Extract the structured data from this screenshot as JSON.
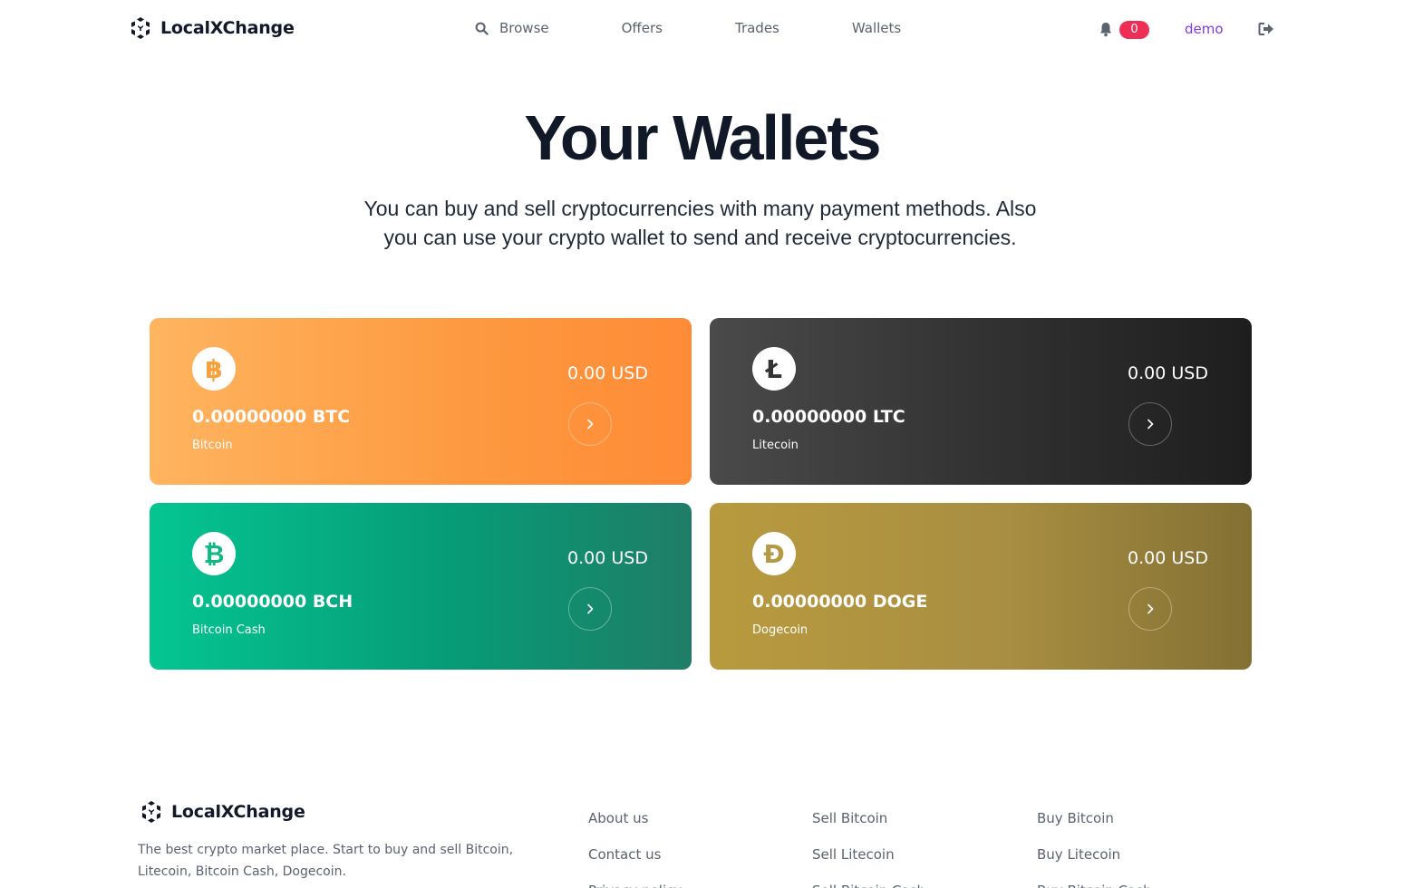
{
  "header": {
    "brand": "LocalXChange",
    "nav": [
      {
        "label": "Browse"
      },
      {
        "label": "Offers"
      },
      {
        "label": "Trades"
      },
      {
        "label": "Wallets"
      }
    ],
    "notification_count": "0",
    "username": "demo"
  },
  "hero": {
    "title": "Your Wallets",
    "subtitle": "You can buy and sell cryptocurrencies with many payment methods. Also you can use your crypto wallet to send and receive cryptocurrencies."
  },
  "wallets": [
    {
      "symbol": "BTC",
      "glyph": "฿",
      "amount": "0.00000000 BTC",
      "name": "Bitcoin",
      "usd": "0.00 USD",
      "color": "#ff9d45"
    },
    {
      "symbol": "LTC",
      "glyph": "Ł",
      "amount": "0.00000000 LTC",
      "name": "Litecoin",
      "usd": "0.00 USD",
      "color": "#333333"
    },
    {
      "symbol": "BCH",
      "glyph": "₿",
      "amount": "0.00000000 BCH",
      "name": "Bitcoin Cash",
      "usd": "0.00 USD",
      "color": "#0ac18e"
    },
    {
      "symbol": "DOGE",
      "glyph": "Đ",
      "amount": "0.00000000 DOGE",
      "name": "Dogecoin",
      "usd": "0.00 USD",
      "color": "#ba9f33"
    }
  ],
  "footer": {
    "brand": "LocalXChange",
    "description": "The best crypto market place. Start to buy and sell Bitcoin, Litecoin, Bitcoin Cash, Dogecoin.",
    "col1": [
      "About us",
      "Contact us",
      "Privacy policy"
    ],
    "col2": [
      "Sell Bitcoin",
      "Sell Litecoin",
      "Sell Bitcoin Cash"
    ],
    "col3": [
      "Buy Bitcoin",
      "Buy Litecoin",
      "Buy Bitcoin Cash"
    ]
  },
  "colors": {
    "accent": "#7c3aed",
    "badge": "#ef2e55",
    "text": "#111827",
    "muted": "#5b6270"
  },
  "icons": {
    "logo": "logo-icon",
    "search": "search-icon",
    "bell": "bell-icon",
    "logout": "logout-icon",
    "go": "chevron-right-icon"
  }
}
